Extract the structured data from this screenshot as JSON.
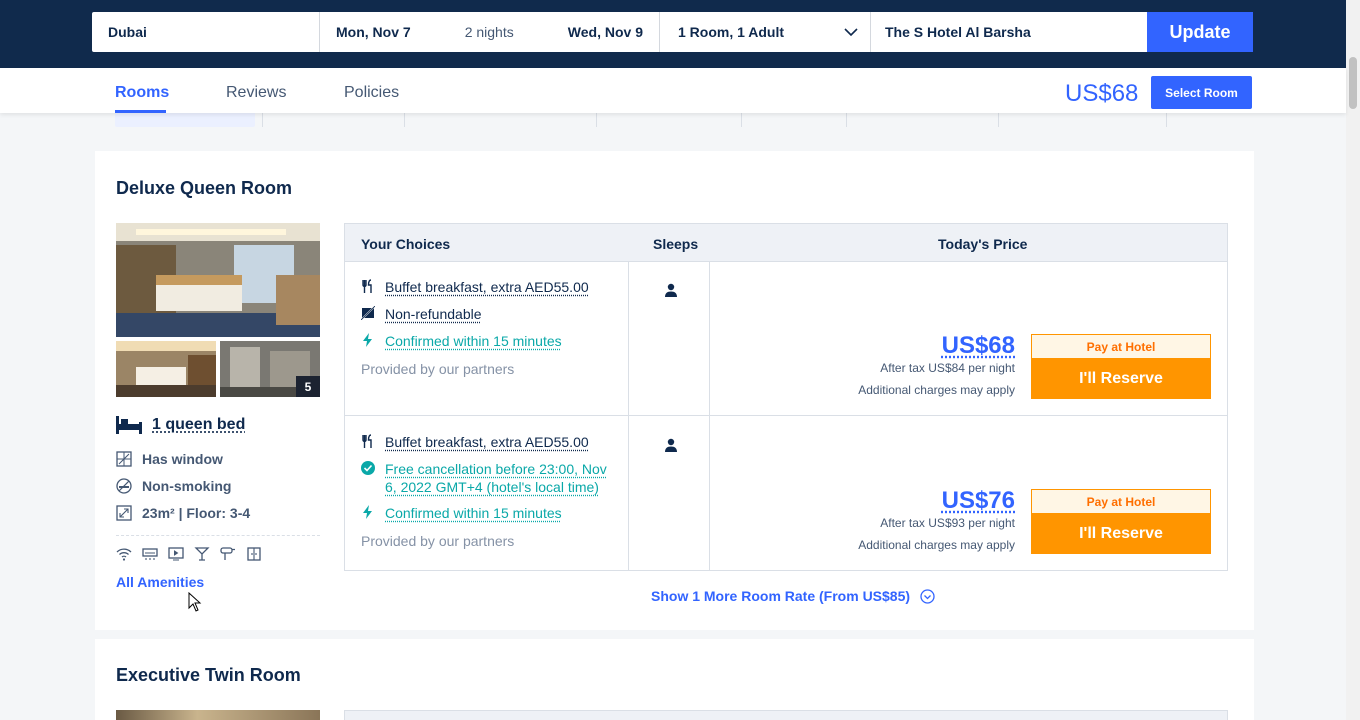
{
  "search": {
    "destination": "Dubai",
    "checkin": "Mon, Nov 7",
    "nights": "2 nights",
    "checkout": "Wed, Nov 9",
    "guests": "1 Room, 1 Adult",
    "hotel": "The S Hotel Al Barsha",
    "update_label": "Update"
  },
  "nav": {
    "tabs": [
      "Rooms",
      "Reviews",
      "Policies"
    ],
    "price": "US$68",
    "select_label": "Select Room"
  },
  "room1": {
    "title": "Deluxe Queen Room",
    "photo_count": "5",
    "bed": "1 queen bed",
    "features": [
      "Has window",
      "Non-smoking",
      "23m² | Floor: 3-4"
    ],
    "all_amenities": "All Amenities",
    "table": {
      "col_choices": "Your Choices",
      "col_sleeps": "Sleeps",
      "col_price": "Today's Price",
      "rates": [
        {
          "choices": [
            "Buffet breakfast, extra AED55.00",
            "Non-refundable",
            "Confirmed within 15 minutes",
            "Provided by our partners"
          ],
          "price": "US$68",
          "after_tax": "After tax US$84 per night",
          "additional": "Additional charges may apply",
          "pay_badge": "Pay at Hotel",
          "reserve": "I'll Reserve"
        },
        {
          "choices": [
            "Buffet breakfast, extra AED55.00",
            "Free cancellation before 23:00, Nov",
            "6, 2022 GMT+4 (hotel's local time)",
            "Confirmed within 15 minutes",
            "Provided by our partners"
          ],
          "price": "US$76",
          "after_tax": "After tax US$93 per night",
          "additional": "Additional charges may apply",
          "pay_badge": "Pay at Hotel",
          "reserve": "I'll Reserve"
        }
      ]
    },
    "more_rates": "Show 1 More Room Rate (From US$85)"
  },
  "room2": {
    "title": "Executive Twin Room"
  }
}
